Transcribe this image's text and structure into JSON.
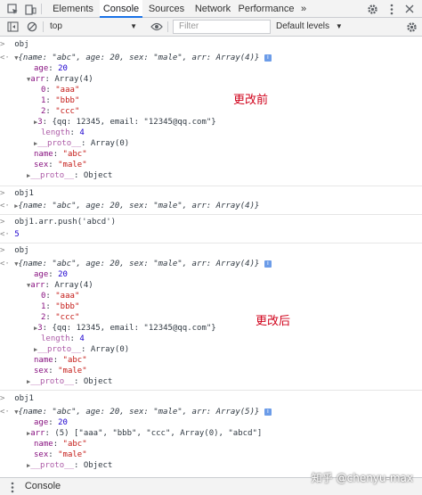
{
  "tabs": [
    "Elements",
    "Console",
    "Sources",
    "Network",
    "Performance"
  ],
  "tab_overflow": "»",
  "toolbar": {
    "context": "top",
    "filter_placeholder": "Filter",
    "levels": "Default levels"
  },
  "log": {
    "cmd1": "obj",
    "obj_preview": "{name: \"abc\", age: 20, sex: \"male\", arr: Array(4)}",
    "age": "20",
    "arr_head": "Array(4)",
    "e0": "\"aaa\"",
    "e1": "\"bbb\"",
    "e2": "\"ccc\"",
    "e3": "{qq: 12345, email: \"12345@qq.com\"}",
    "length": "4",
    "proto_arr": "Array(0)",
    "name": "\"abc\"",
    "sex": "\"male\"",
    "proto_obj": "Object",
    "cmd2": "obj1",
    "cmd3": "obj1.arr.push('abcd')",
    "ret3": "5",
    "cmd4": "obj",
    "cmd5": "obj1",
    "obj1_preview2": "{name: \"abc\", age: 20, sex: \"male\", arr: Array(5)}",
    "arr5": "(5) [\"aaa\", \"bbb\", \"ccc\", Array(0), \"abcd\"]"
  },
  "annotations": {
    "before": "更改前",
    "after": "更改后"
  },
  "drawer": {
    "label": "Console"
  },
  "watermark": "知乎 @chenyu-max",
  "colors": {
    "string": "#c41a16",
    "number": "#1c00cf",
    "key": "#881280",
    "annotation": "#d0021b",
    "active_tab": "#1a73e8"
  }
}
